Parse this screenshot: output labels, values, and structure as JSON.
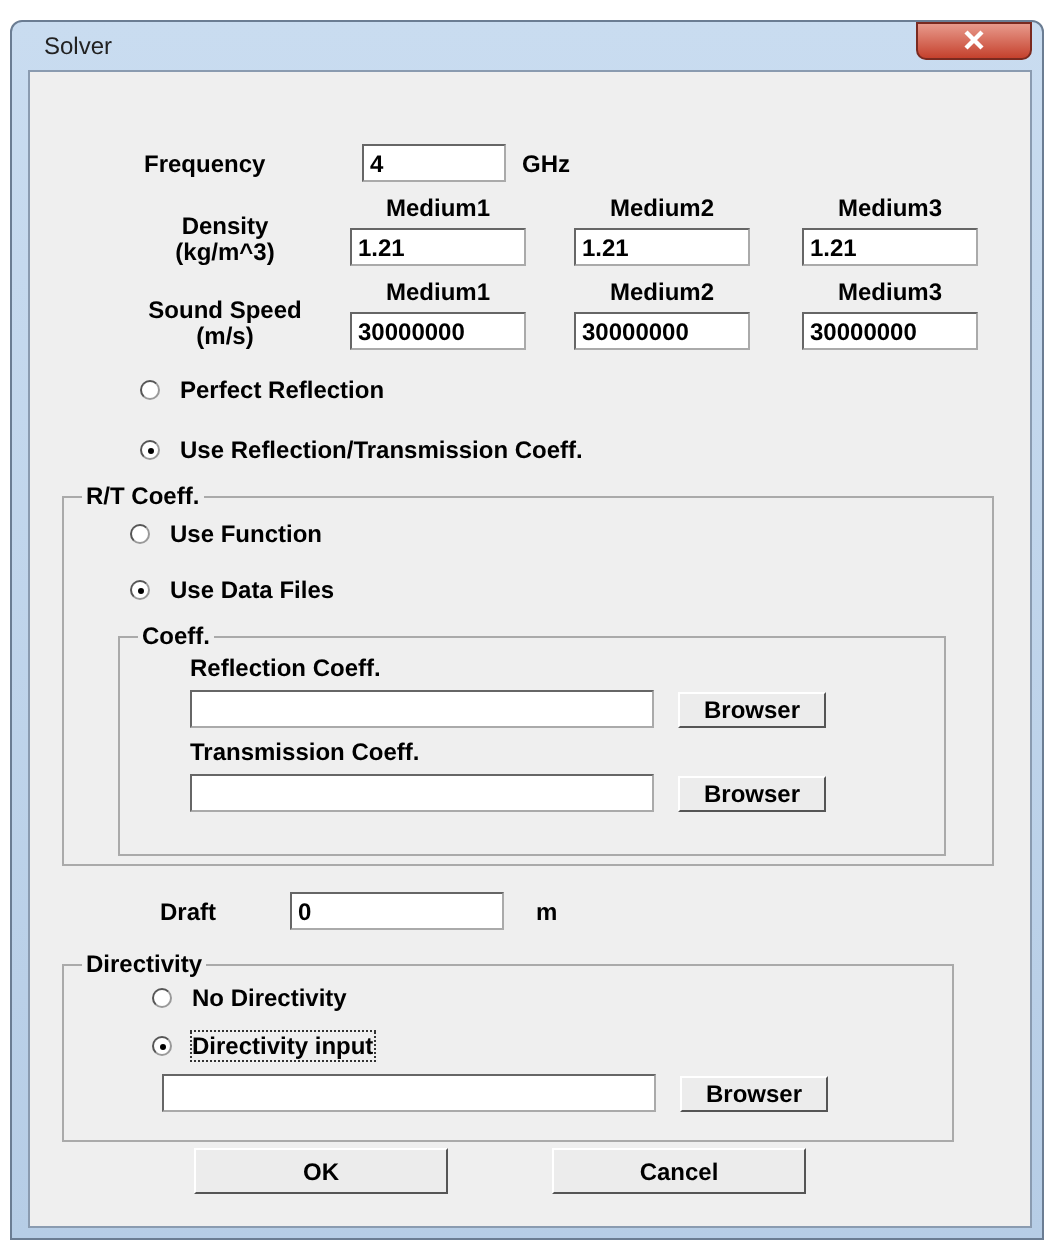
{
  "window": {
    "title": "Solver"
  },
  "frequency": {
    "label": "Frequency",
    "value": "4",
    "unit": "GHz"
  },
  "density": {
    "label_lines": [
      "Density",
      "(kg/m^3)"
    ],
    "columns": [
      "Medium1",
      "Medium2",
      "Medium3"
    ],
    "values": [
      "1.21",
      "1.21",
      "1.21"
    ]
  },
  "sound_speed": {
    "label_lines": [
      "Sound Speed",
      "(m/s)"
    ],
    "columns": [
      "Medium1",
      "Medium2",
      "Medium3"
    ],
    "values": [
      "30000000",
      "30000000",
      "30000000"
    ]
  },
  "mode_options": [
    {
      "label": "Perfect Reflection",
      "selected": false
    },
    {
      "label": "Use Reflection/Transmission Coeff.",
      "selected": true
    }
  ],
  "rt_coeff": {
    "title": "R/T Coeff.",
    "options": [
      {
        "label": "Use Function",
        "selected": false
      },
      {
        "label": "Use Data Files",
        "selected": true
      }
    ],
    "coeff": {
      "title": "Coeff.",
      "files": [
        {
          "label": "Reflection Coeff.",
          "button": "Browser"
        },
        {
          "label": "Transmission Coeff.",
          "button": "Browser"
        }
      ]
    }
  },
  "draft": {
    "label": "Draft",
    "value": "0",
    "unit": "m"
  },
  "directivity": {
    "title": "Directivity",
    "options": [
      {
        "label": "No Directivity",
        "selected": false,
        "focused": false
      },
      {
        "label": "Directivity input",
        "selected": true,
        "focused": true
      }
    ],
    "button": "Browser"
  },
  "buttons": [
    "OK",
    "Cancel"
  ]
}
